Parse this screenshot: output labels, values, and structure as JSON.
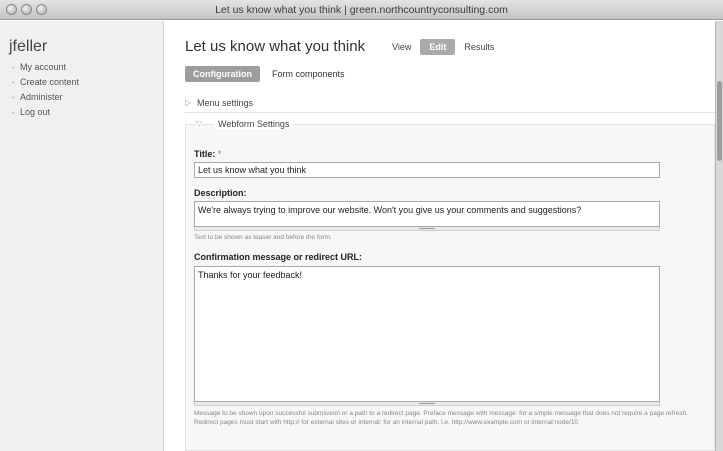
{
  "window": {
    "title": "Let us know what you think | green.northcountryconsulting.com"
  },
  "sidebar": {
    "username": "jfeller",
    "items": [
      {
        "label": "My account"
      },
      {
        "label": "Create content"
      },
      {
        "label": "Administer"
      },
      {
        "label": "Log out"
      }
    ]
  },
  "main": {
    "page_title": "Let us know what you think",
    "tabs": [
      {
        "label": "View",
        "active": false
      },
      {
        "label": "Edit",
        "active": true
      },
      {
        "label": "Results",
        "active": false
      }
    ],
    "subtabs": [
      {
        "label": "Configuration",
        "active": true
      },
      {
        "label": "Form components",
        "active": false
      }
    ],
    "menu_settings": {
      "label": "Menu settings"
    },
    "webform_settings": {
      "label": "Webform Settings",
      "title_field": {
        "label": "Title:",
        "required_mark": "*",
        "value": "Let us know what you think"
      },
      "description_field": {
        "label": "Description:",
        "value": "We're always trying to improve our website. Won't you give us your comments and suggestions?",
        "help": "Text to be shown as teaser and before the form."
      },
      "confirmation_field": {
        "label": "Confirmation message or redirect URL:",
        "value": "Thanks for your feedback!",
        "help": "Message to be shown upon successful submission or a path to a redirect page. Preface message with message: for a simple message that does not require a page refresh. Redirect pages must start with http:// for external sites or internal: for an internal path. i.e. http://www.example.com or internal:node/10"
      }
    }
  }
}
